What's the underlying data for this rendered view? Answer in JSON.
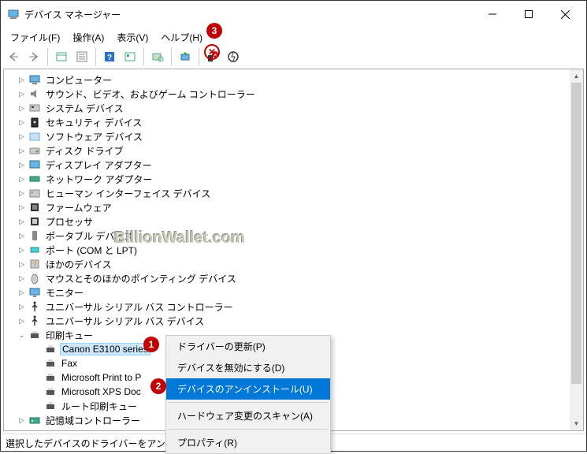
{
  "window": {
    "title": "デバイス マネージャー"
  },
  "menu": {
    "file": "ファイル(F)",
    "action": "操作(A)",
    "view": "表示(V)",
    "help": "ヘルプ(H)"
  },
  "tree": {
    "items": [
      {
        "label": "コンピューター"
      },
      {
        "label": "サウンド、ビデオ、およびゲーム コントローラー"
      },
      {
        "label": "システム デバイス"
      },
      {
        "label": "セキュリティ デバイス"
      },
      {
        "label": "ソフトウェア デバイス"
      },
      {
        "label": "ディスク ドライブ"
      },
      {
        "label": "ディスプレイ アダプター"
      },
      {
        "label": "ネットワーク アダプター"
      },
      {
        "label": "ヒューマン インターフェイス デバイス"
      },
      {
        "label": "ファームウェア"
      },
      {
        "label": "プロセッサ"
      },
      {
        "label": "ポータブル デバイス"
      },
      {
        "label": "ポート (COM と LPT)"
      },
      {
        "label": "ほかのデバイス"
      },
      {
        "label": "マウスとそのほかのポインティング デバイス"
      },
      {
        "label": "モニター"
      },
      {
        "label": "ユニバーサル シリアル バス コントローラー"
      },
      {
        "label": "ユニバーサル シリアル バス デバイス"
      }
    ],
    "printqueue_label": "印刷キュー",
    "printers": [
      {
        "label": "Canon E3100 series"
      },
      {
        "label": "Fax"
      },
      {
        "label": "Microsoft Print to P"
      },
      {
        "label": "Microsoft XPS Doc"
      },
      {
        "label": "ルート印刷キュー"
      }
    ],
    "memory_label": "記憶域コントローラー"
  },
  "context": {
    "update": "ドライバーの更新(P)",
    "disable": "デバイスを無効にする(D)",
    "uninstall": "デバイスのアンインストール(U)",
    "scan": "ハードウェア変更のスキャン(A)",
    "properties": "プロパティ(R)"
  },
  "status": "選択したデバイスのドライバーをアンインスト",
  "markers": {
    "m1": "1",
    "m2": "2",
    "m3": "3"
  },
  "watermark": "BillionWallet.com"
}
